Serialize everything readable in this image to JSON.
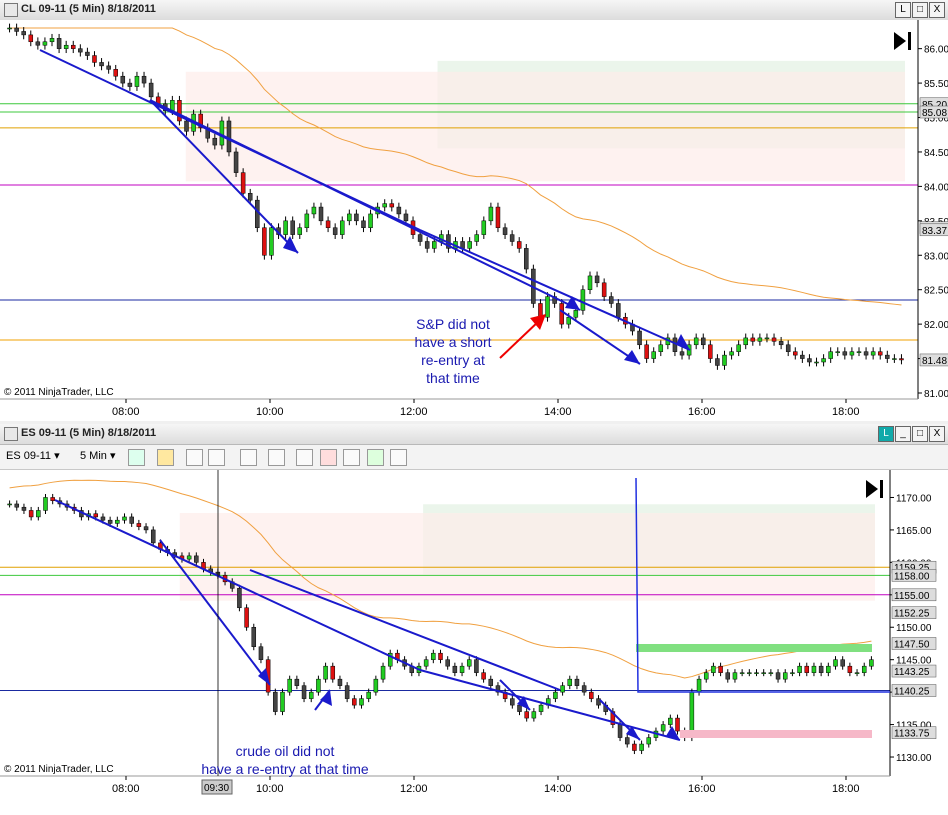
{
  "top_window": {
    "title": "CL 09-11 (5 Min)  8/18/2011",
    "buttons": [
      "L",
      "□",
      "X"
    ],
    "copyright": "© 2011 NinjaTrader, LLC",
    "annotation": [
      "S&P did not",
      "have a short",
      "re-entry at",
      "that time"
    ]
  },
  "bottom_window": {
    "title": "ES 09-11 (5 Min)  8/18/2011",
    "buttons": [
      "L",
      "_",
      "□",
      "X"
    ],
    "toolbar": {
      "instrument": "ES 09-11",
      "interval": "5 Min"
    },
    "copyright": "© 2011 NinjaTrader, LLC",
    "annotation": [
      "crude oil did not",
      "have a re-entry at that time"
    ],
    "crosshair_time": "09:30"
  },
  "chart_data": [
    {
      "type": "candlestick",
      "title": "CL 09-11 (5 Min)  8/18/2011",
      "x_ticks": [
        "08:00",
        "10:00",
        "12:00",
        "14:00",
        "16:00",
        "18:00"
      ],
      "y_ticks": [
        81.0,
        81.5,
        82.0,
        82.5,
        83.0,
        83.5,
        84.0,
        84.5,
        85.0,
        85.5,
        86.0
      ],
      "ylim": [
        81.0,
        86.3
      ],
      "price_labels": [
        "85.20",
        "85.08",
        "83.40",
        "83.37",
        "81.48"
      ],
      "hlines": [
        {
          "y": 85.2,
          "color": "#3cc83c"
        },
        {
          "y": 85.08,
          "color": "#3cc83c"
        },
        {
          "y": 84.85,
          "color": "#e0a000"
        },
        {
          "y": 84.02,
          "color": "#c000c0"
        },
        {
          "y": 82.35,
          "color": "#1a2aa0"
        },
        {
          "y": 81.77,
          "color": "#f0a000"
        }
      ],
      "closes": [
        86.3,
        86.25,
        86.2,
        86.1,
        86.05,
        86.1,
        86.15,
        86.0,
        86.05,
        86.0,
        85.95,
        85.9,
        85.8,
        85.75,
        85.7,
        85.6,
        85.5,
        85.45,
        85.6,
        85.5,
        85.3,
        85.2,
        85.1,
        85.25,
        84.95,
        84.8,
        85.05,
        84.85,
        84.7,
        84.6,
        84.95,
        84.5,
        84.2,
        83.9,
        83.8,
        83.4,
        83.0,
        83.4,
        83.3,
        83.5,
        83.3,
        83.4,
        83.6,
        83.7,
        83.5,
        83.4,
        83.3,
        83.5,
        83.6,
        83.5,
        83.4,
        83.6,
        83.7,
        83.75,
        83.7,
        83.6,
        83.5,
        83.3,
        83.2,
        83.1,
        83.2,
        83.3,
        83.1,
        83.2,
        83.1,
        83.2,
        83.3,
        83.5,
        83.7,
        83.4,
        83.3,
        83.2,
        83.1,
        82.8,
        82.3,
        82.1,
        82.4,
        82.3,
        82.0,
        82.1,
        82.2,
        82.5,
        82.7,
        82.6,
        82.4,
        82.3,
        82.1,
        82.0,
        81.9,
        81.7,
        81.5,
        81.6,
        81.7,
        81.8,
        81.6,
        81.55,
        81.7,
        81.8,
        81.7,
        81.5,
        81.4,
        81.55,
        81.6,
        81.7,
        81.8,
        81.75,
        81.8,
        81.8,
        81.75,
        81.7,
        81.6,
        81.55,
        81.5,
        81.45,
        81.45,
        81.5,
        81.6,
        81.6,
        81.55,
        81.6,
        81.6,
        81.55,
        81.6,
        81.55,
        81.5,
        81.5,
        81.48
      ]
    },
    {
      "type": "candlestick",
      "title": "ES 09-11 (5 Min)  8/18/2011",
      "x_ticks": [
        "08:00",
        "10:00",
        "12:00",
        "14:00",
        "16:00",
        "18:00"
      ],
      "y_ticks": [
        1130,
        1135,
        1140,
        1145,
        1150,
        1155,
        1160,
        1165,
        1170
      ],
      "ylim": [
        1128.0,
        1173.0
      ],
      "price_labels": [
        "1159.25",
        "1158.00",
        "1155.00",
        "1152.25",
        "1147.50",
        "1143.25",
        "1140.25",
        "1133.75"
      ],
      "hlines": [
        {
          "y": 1159.25,
          "color": "#e0a000"
        },
        {
          "y": 1158.0,
          "color": "#3cc83c"
        },
        {
          "y": 1155.0,
          "color": "#c000c0"
        },
        {
          "y": 1140.25,
          "color": "#1a2aa0"
        }
      ],
      "closes": [
        1169,
        1168.5,
        1168,
        1167,
        1168,
        1170,
        1169.5,
        1169,
        1168.5,
        1168,
        1167,
        1167.5,
        1167,
        1166.5,
        1166,
        1166.5,
        1167,
        1166,
        1165.5,
        1165,
        1163,
        1162,
        1161.5,
        1161,
        1160.5,
        1161,
        1160,
        1159,
        1158.5,
        1158,
        1157,
        1156,
        1153,
        1150,
        1147,
        1145,
        1140,
        1137,
        1140,
        1142,
        1141,
        1139,
        1140,
        1142,
        1144,
        1142,
        1141,
        1139,
        1138,
        1139,
        1140,
        1142,
        1144,
        1146,
        1145,
        1144,
        1143,
        1144,
        1145,
        1146,
        1145,
        1144,
        1143,
        1144,
        1145,
        1143,
        1142,
        1141,
        1140,
        1139,
        1138,
        1137,
        1136,
        1137,
        1138,
        1139,
        1140,
        1141,
        1142,
        1141,
        1140,
        1139,
        1138,
        1137,
        1135,
        1133,
        1132,
        1131,
        1132,
        1133,
        1134,
        1135,
        1136,
        1134,
        1133,
        1140,
        1142,
        1143,
        1144,
        1143,
        1142,
        1143,
        1143,
        1143,
        1143,
        1143,
        1143,
        1142,
        1143,
        1143,
        1144,
        1143,
        1144,
        1143,
        1144,
        1145,
        1144,
        1143,
        1143,
        1144,
        1145
      ]
    }
  ]
}
